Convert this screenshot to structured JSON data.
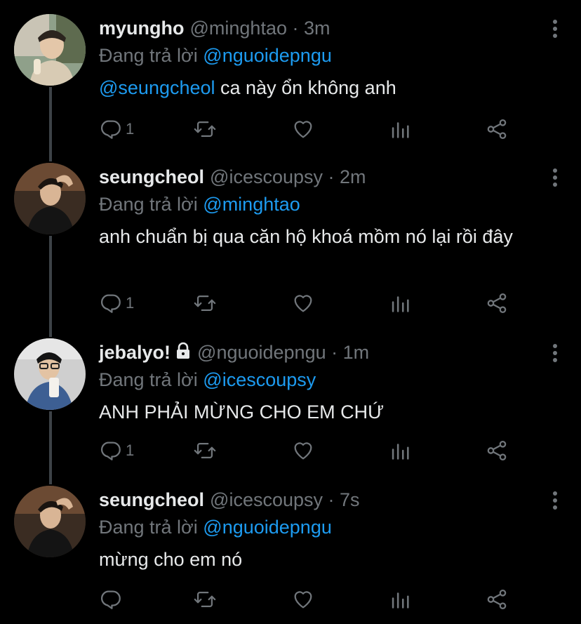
{
  "replying_prefix": "Đang trả lời",
  "tweets": [
    {
      "name": "myungho",
      "handle": "@minghtao",
      "time": "3m",
      "replying_to": "@nguoidepngu",
      "mention": "@seungcheol",
      "text": " ca này ổn không anh",
      "reply_count": "1"
    },
    {
      "name": "seungcheol",
      "handle": "@icescoupsy",
      "time": "2m",
      "replying_to": "@minghtao",
      "mention": "",
      "text": "anh chuẩn bị qua căn hộ khoá mồm nó lại rồi đây",
      "reply_count": "1"
    },
    {
      "name": "jebalyo!",
      "handle": "@nguoidepngu",
      "time": "1m",
      "replying_to": "@icescoupsy",
      "mention": "",
      "text": "ANH PHẢI MỪNG CHO EM CHỨ",
      "reply_count": "1",
      "protected": true
    },
    {
      "name": "seungcheol",
      "handle": "@icescoupsy",
      "time": "7s",
      "replying_to": "@nguoidepngu",
      "mention": "",
      "text": "mừng cho em nó",
      "reply_count": ""
    }
  ],
  "colors": {
    "background": "#000000",
    "text": "#e7e9ea",
    "muted": "#71767b",
    "link": "#1d9bf0",
    "thread_line": "#3d4247"
  },
  "icons": [
    "reply-icon",
    "retweet-icon",
    "like-icon",
    "views-icon",
    "share-icon",
    "more-icon",
    "lock-icon"
  ]
}
